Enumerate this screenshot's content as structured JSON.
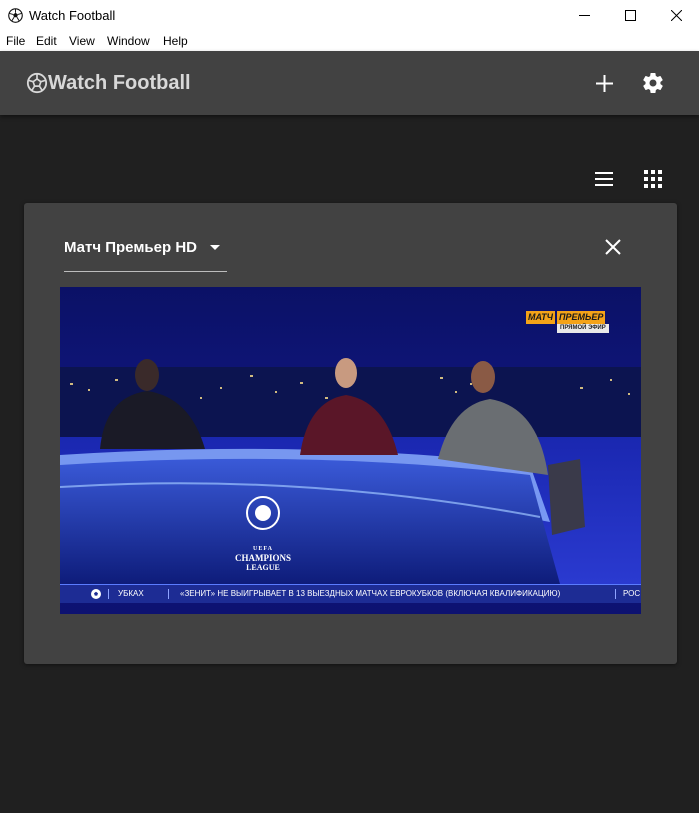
{
  "window": {
    "title": "Watch Football"
  },
  "menu": {
    "file": "File",
    "edit": "Edit",
    "view": "View",
    "window": "Window",
    "help": "Help"
  },
  "header": {
    "brand": "Watch Football",
    "add_icon": "plus-icon",
    "settings_icon": "gear-icon"
  },
  "view_toggle": {
    "list_icon": "list-view-icon",
    "grid_icon": "grid-view-icon"
  },
  "player": {
    "channel": "Матч Премьер HD",
    "logo_left": "МАТЧ",
    "logo_right": "ПРЕМЬЕР",
    "logo_sub": "ПРЯМОЙ ЭФИР",
    "ucl_top": "UEFA",
    "ucl_mid": "CHAMPIONS",
    "ucl_bottom": "LEAGUE",
    "ticker_1": "УБКАХ",
    "ticker_2": "«ЗЕНИТ» НЕ ВЫИГРЫВАЕТ В 13 ВЫЕЗДНЫХ МАТЧАХ ЕВРОКУБКОВ (ВКЛЮЧАЯ КВАЛИФИКАЦИЮ)",
    "ticker_3": "РОС"
  },
  "colors": {
    "background": "#202020",
    "appbar": "#424242",
    "card": "#424242",
    "accent_logo": "#f4a318"
  }
}
